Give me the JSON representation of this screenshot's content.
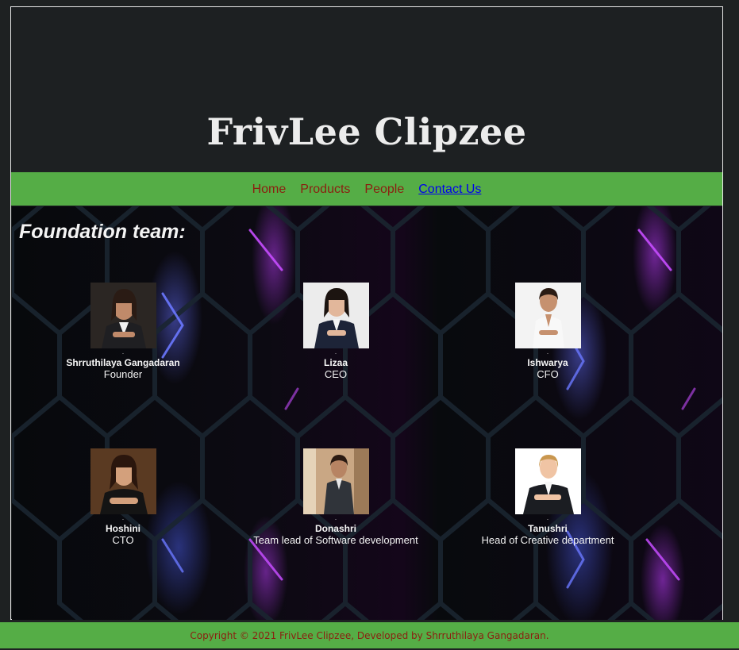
{
  "site": {
    "title": "FrivLee Clipzee"
  },
  "nav": {
    "items": [
      {
        "label": "Home"
      },
      {
        "label": "Products"
      },
      {
        "label": "People"
      },
      {
        "label": "Contact Us"
      }
    ]
  },
  "main": {
    "section_title": "Foundation team:",
    "members": [
      {
        "name": "Shrruthilaya Gangadaran",
        "role": "Founder",
        "dot": "."
      },
      {
        "name": "Lizaa",
        "role": "CEO",
        "dot": "."
      },
      {
        "name": "Ishwarya",
        "role": "CFO",
        "dot": "."
      },
      {
        "name": "Hoshini",
        "role": "CTO",
        "dot": "."
      },
      {
        "name": "Donashri",
        "role": "Team lead of Software development",
        "dot": "."
      },
      {
        "name": "Tanushri",
        "role": "Head of Creative department",
        "dot": "."
      }
    ]
  },
  "footer": {
    "text": "Copyright © 2021 FrivLee Clipzee, Developed by Shrruthilaya Gangadaran."
  },
  "colors": {
    "accent_green": "#55ad46",
    "nav_text": "#8b1f10",
    "link": "#0000ee",
    "header_bg": "#1d2022"
  }
}
